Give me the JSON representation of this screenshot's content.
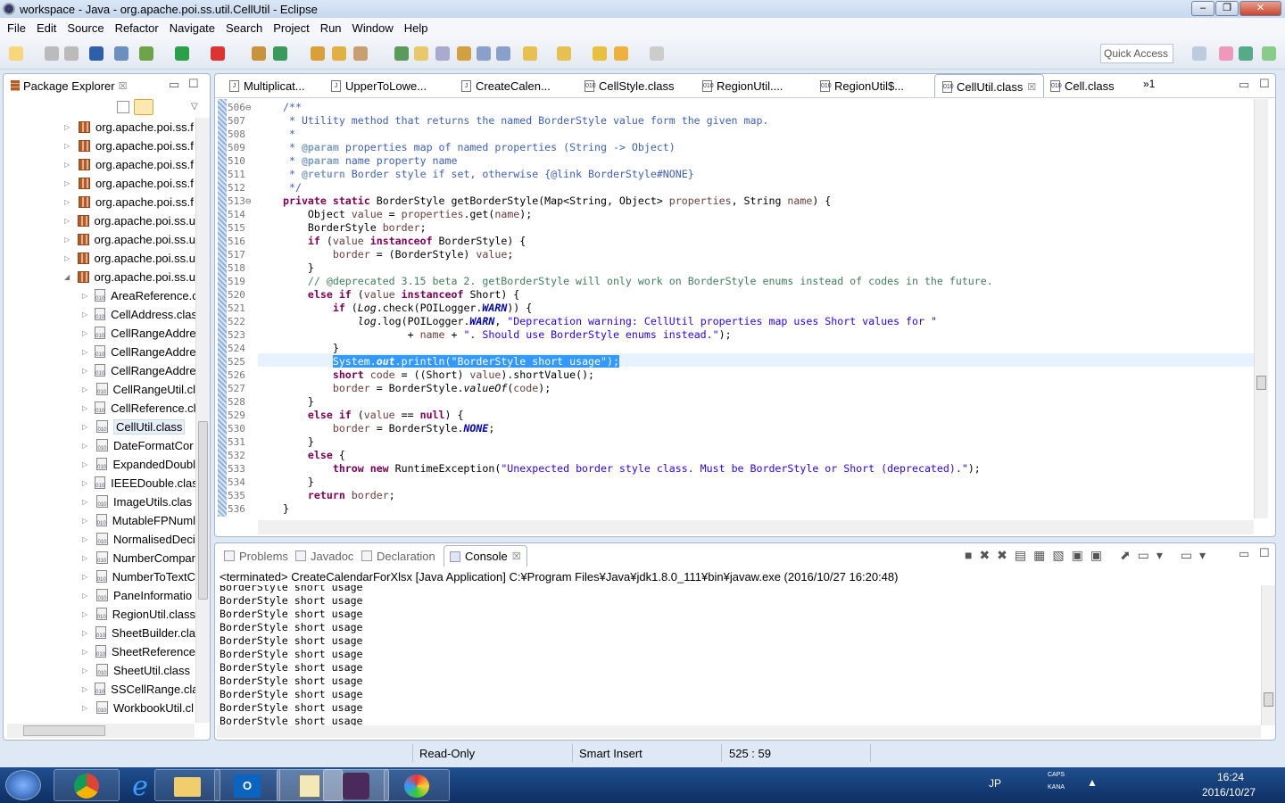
{
  "window": {
    "title": "workspace - Java - org.apache.poi.ss.util.CellUtil - Eclipse",
    "min": "‒",
    "max": "❐",
    "close": "✕"
  },
  "menu": [
    "File",
    "Edit",
    "Source",
    "Refactor",
    "Navigate",
    "Search",
    "Project",
    "Run",
    "Window",
    "Help"
  ],
  "toolbar": {
    "quick_access": "Quick Access"
  },
  "package_explorer": {
    "title": "Package Explorer",
    "close": "☒",
    "items": [
      {
        "label": "org.apache.poi.ss.f",
        "type": "pkg",
        "expanded": false,
        "depth": 0
      },
      {
        "label": "org.apache.poi.ss.f",
        "type": "pkg",
        "expanded": false,
        "depth": 0
      },
      {
        "label": "org.apache.poi.ss.f",
        "type": "pkg",
        "expanded": false,
        "depth": 0
      },
      {
        "label": "org.apache.poi.ss.f",
        "type": "pkg",
        "expanded": false,
        "depth": 0
      },
      {
        "label": "org.apache.poi.ss.f",
        "type": "pkg",
        "expanded": false,
        "depth": 0
      },
      {
        "label": "org.apache.poi.ss.u",
        "type": "pkg",
        "expanded": false,
        "depth": 0
      },
      {
        "label": "org.apache.poi.ss.u",
        "type": "pkg",
        "expanded": false,
        "depth": 0
      },
      {
        "label": "org.apache.poi.ss.u",
        "type": "pkg",
        "expanded": false,
        "depth": 0
      },
      {
        "label": "org.apache.poi.ss.u",
        "type": "pkg",
        "expanded": true,
        "depth": 0
      },
      {
        "label": "AreaReference.c",
        "type": "cls",
        "depth": 1
      },
      {
        "label": "CellAddress.clas",
        "type": "cls",
        "depth": 1
      },
      {
        "label": "CellRangeAddre",
        "type": "cls",
        "depth": 1
      },
      {
        "label": "CellRangeAddre",
        "type": "cls",
        "depth": 1
      },
      {
        "label": "CellRangeAddre",
        "type": "cls",
        "depth": 1
      },
      {
        "label": "CellRangeUtil.cl",
        "type": "cls",
        "depth": 1
      },
      {
        "label": "CellReference.cl",
        "type": "cls",
        "depth": 1
      },
      {
        "label": "CellUtil.class",
        "type": "cls",
        "depth": 1,
        "selected": true
      },
      {
        "label": "DateFormatCor",
        "type": "cls",
        "depth": 1
      },
      {
        "label": "ExpandedDoubl",
        "type": "cls",
        "depth": 1
      },
      {
        "label": "IEEEDouble.clas",
        "type": "cls",
        "depth": 1
      },
      {
        "label": "ImageUtils.clas",
        "type": "cls",
        "depth": 1
      },
      {
        "label": "MutableFPNuml",
        "type": "cls",
        "depth": 1
      },
      {
        "label": "NormalisedDeci",
        "type": "cls",
        "depth": 1
      },
      {
        "label": "NumberCompar",
        "type": "cls",
        "depth": 1
      },
      {
        "label": "NumberToTextC",
        "type": "cls",
        "depth": 1
      },
      {
        "label": "PaneInformatio",
        "type": "cls",
        "depth": 1
      },
      {
        "label": "RegionUtil.class",
        "type": "cls",
        "depth": 1
      },
      {
        "label": "SheetBuilder.cla",
        "type": "cls",
        "depth": 1
      },
      {
        "label": "SheetReference",
        "type": "cls",
        "depth": 1
      },
      {
        "label": "SheetUtil.class",
        "type": "cls",
        "depth": 1
      },
      {
        "label": "SSCellRange.cla",
        "type": "cls",
        "depth": 1
      },
      {
        "label": "WorkbookUtil.cl",
        "type": "cls",
        "depth": 1
      }
    ]
  },
  "editor": {
    "tabs": [
      {
        "label": "Multiplicat...",
        "type": "java"
      },
      {
        "label": "UpperToLowe...",
        "type": "java"
      },
      {
        "label": "CreateCalen...",
        "type": "java"
      },
      {
        "label": "CellStyle.class",
        "type": "class"
      },
      {
        "label": "RegionUtil....",
        "type": "class"
      },
      {
        "label": "RegionUtil$...",
        "type": "class"
      },
      {
        "label": "CellUtil.class",
        "type": "class",
        "active": true
      },
      {
        "label": "Cell.class",
        "type": "class"
      }
    ],
    "overflow": "»1",
    "first_line": 506,
    "lines": [
      [
        [
          "jd",
          "/**"
        ]
      ],
      [
        [
          "jd",
          " * Utility method that returns the named BorderStyle value form the given map."
        ]
      ],
      [
        [
          "jd",
          " *"
        ]
      ],
      [
        [
          "jd",
          " * "
        ],
        [
          "jt",
          "@param"
        ],
        [
          "jd",
          " properties map of named properties (String -> Object)"
        ]
      ],
      [
        [
          "jd",
          " * "
        ],
        [
          "jt",
          "@param"
        ],
        [
          "jd",
          " name property name"
        ]
      ],
      [
        [
          "jd",
          " * "
        ],
        [
          "jt",
          "@return"
        ],
        [
          "jd",
          " Border style if set, otherwise {@link BorderStyle#NONE}"
        ]
      ],
      [
        [
          "jd",
          " */"
        ]
      ],
      [
        [
          "k",
          "private static"
        ],
        [
          "n",
          " BorderStyle getBorderStyle(Map<String, Object> "
        ],
        [
          "v",
          "properties"
        ],
        [
          "n",
          ", String "
        ],
        [
          "v",
          "name"
        ],
        [
          "n",
          ") {"
        ]
      ],
      [
        [
          "n",
          "    Object "
        ],
        [
          "v",
          "value"
        ],
        [
          "n",
          " = "
        ],
        [
          "v",
          "properties"
        ],
        [
          "n",
          ".get("
        ],
        [
          "v",
          "name"
        ],
        [
          "n",
          ");"
        ]
      ],
      [
        [
          "n",
          "    BorderStyle "
        ],
        [
          "v",
          "border"
        ],
        [
          "n",
          ";"
        ]
      ],
      [
        [
          "n",
          "    "
        ],
        [
          "k",
          "if"
        ],
        [
          "n",
          " ("
        ],
        [
          "v",
          "value"
        ],
        [
          "n",
          " "
        ],
        [
          "k",
          "instanceof"
        ],
        [
          "n",
          " BorderStyle) {"
        ]
      ],
      [
        [
          "n",
          "        "
        ],
        [
          "v",
          "border"
        ],
        [
          "n",
          " = (BorderStyle) "
        ],
        [
          "v",
          "value"
        ],
        [
          "n",
          ";"
        ]
      ],
      [
        [
          "n",
          "    }"
        ]
      ],
      [
        [
          "c",
          "    // @deprecated 3.15 beta 2. getBorderStyle will only work on BorderStyle enums instead of codes in the future."
        ]
      ],
      [
        [
          "n",
          "    "
        ],
        [
          "k",
          "else if"
        ],
        [
          "n",
          " ("
        ],
        [
          "v",
          "value"
        ],
        [
          "n",
          " "
        ],
        [
          "k",
          "instanceof"
        ],
        [
          "n",
          " Short) {"
        ]
      ],
      [
        [
          "n",
          "        "
        ],
        [
          "k",
          "if"
        ],
        [
          "n",
          " ("
        ],
        [
          "i",
          "Log"
        ],
        [
          "n",
          ".check(POILogger."
        ],
        [
          "f",
          "WARN"
        ],
        [
          "n",
          ")) {"
        ]
      ],
      [
        [
          "n",
          "            "
        ],
        [
          "i",
          "log"
        ],
        [
          "n",
          ".log(POILogger."
        ],
        [
          "f",
          "WARN"
        ],
        [
          "n",
          ", "
        ],
        [
          "s",
          "\"Deprecation warning: CellUtil properties map uses Short values for \""
        ]
      ],
      [
        [
          "n",
          "                    + "
        ],
        [
          "v",
          "name"
        ],
        [
          "n",
          " + "
        ],
        [
          "s",
          "\". Should use BorderStyle enums instead.\""
        ],
        [
          "n",
          ");"
        ]
      ],
      [
        [
          "n",
          "        }"
        ]
      ],
      [
        [
          "n",
          "        "
        ],
        [
          "sel",
          "System."
        ],
        [
          "self",
          "out"
        ],
        [
          "sel",
          ".println(\"BorderStyle short usage\");"
        ]
      ],
      [
        [
          "n",
          "        "
        ],
        [
          "k",
          "short"
        ],
        [
          "n",
          " "
        ],
        [
          "v",
          "code"
        ],
        [
          "n",
          " = ((Short) "
        ],
        [
          "v",
          "value"
        ],
        [
          "n",
          ").shortValue();"
        ]
      ],
      [
        [
          "n",
          "        "
        ],
        [
          "v",
          "border"
        ],
        [
          "n",
          " = BorderStyle."
        ],
        [
          "i",
          "valueOf"
        ],
        [
          "n",
          "("
        ],
        [
          "v",
          "code"
        ],
        [
          "n",
          ");"
        ]
      ],
      [
        [
          "n",
          "    }"
        ]
      ],
      [
        [
          "n",
          "    "
        ],
        [
          "k",
          "else if"
        ],
        [
          "n",
          " ("
        ],
        [
          "v",
          "value"
        ],
        [
          "n",
          " == "
        ],
        [
          "k",
          "null"
        ],
        [
          "n",
          ") {"
        ]
      ],
      [
        [
          "n",
          "        "
        ],
        [
          "v",
          "border"
        ],
        [
          "n",
          " = BorderStyle."
        ],
        [
          "f",
          "NONE"
        ],
        [
          "n",
          ";"
        ]
      ],
      [
        [
          "n",
          "    }"
        ]
      ],
      [
        [
          "n",
          "    "
        ],
        [
          "k",
          "else"
        ],
        [
          "n",
          " {"
        ]
      ],
      [
        [
          "n",
          "        "
        ],
        [
          "k",
          "throw new"
        ],
        [
          "n",
          " RuntimeException("
        ],
        [
          "s",
          "\"Unexpected border style class. Must be BorderStyle or Short (deprecated).\""
        ],
        [
          "n",
          ");"
        ]
      ],
      [
        [
          "n",
          "    }"
        ]
      ],
      [
        [
          "n",
          "    "
        ],
        [
          "k",
          "return"
        ],
        [
          "n",
          " "
        ],
        [
          "v",
          "border"
        ],
        [
          "n",
          ";"
        ]
      ],
      [
        [
          "n",
          "}"
        ]
      ],
      [
        [
          "n",
          ""
        ]
      ]
    ]
  },
  "bottom": {
    "tabs": [
      {
        "label": "Problems"
      },
      {
        "label": "Javadoc"
      },
      {
        "label": "Declaration"
      },
      {
        "label": "Console",
        "active": true
      }
    ],
    "console_header": "<terminated> CreateCalendarForXlsx [Java Application] C:¥Program Files¥Java¥jdk1.8.0_111¥bin¥javaw.exe (2016/10/27 16:20:48)",
    "console_lines": [
      "BorderStyle short usage",
      "BorderStyle short usage",
      "BorderStyle short usage",
      "BorderStyle short usage",
      "BorderStyle short usage",
      "BorderStyle short usage",
      "BorderStyle short usage",
      "BorderStyle short usage",
      "BorderStyle short usage",
      "BorderStyle short usage",
      "BorderStyle short usage"
    ]
  },
  "status": {
    "mode": "Read-Only",
    "insert": "Smart Insert",
    "position": "525 : 59"
  },
  "taskbar": {
    "lang": "JP",
    "time": "16:24",
    "date": "2016/10/27",
    "caps": "CAPS",
    "kana": "KANA"
  }
}
